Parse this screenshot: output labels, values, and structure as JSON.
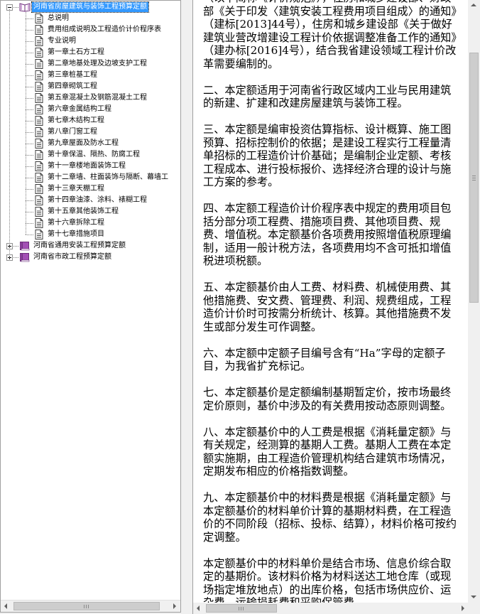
{
  "tree": {
    "books": [
      {
        "label": "河南省房屋建筑与装饰工程预算定额",
        "selected": true,
        "expanded": true,
        "children": [
          "总说明",
          "费用组成说明及工程造价计价程序表",
          "专业说明",
          "第一章土石方工程",
          "第二章地基处理及边坡支护工程",
          "第三章桩基工程",
          "第四章砌筑工程",
          "第五章混凝土及钢筋混凝土工程",
          "第六章金属结构工程",
          "第七章木结构工程",
          "第八章门窗工程",
          "第九章屋面及防水工程",
          "第十章保温、隔热、防腐工程",
          "第十一章楼地面装饰工程",
          "第十二章墙、柱面装饰与隔断、幕墙工",
          "第十三章天棚工程",
          "第十四章油漆、涂料、裱糊工程",
          "第十五章其他装饰工程",
          "第十六章拆除工程",
          "第十七章措施项目"
        ]
      },
      {
        "label": "河南省通用安装工程预算定额",
        "selected": false,
        "expanded": false,
        "children": []
      },
      {
        "label": "河南省市政工程预算定额",
        "selected": false,
        "expanded": false,
        "children": []
      }
    ]
  },
  "document": {
    "paragraphs": [
      "（以下简称《计价规范》），住房和城乡建设部、财政部《关于印发〈建筑安装工程费用项目组成〉的通知》（建标[2013]44号），住房和城乡建设部《关于做好建筑业营改增建设工程计价依据调整准备工作的通知》（建办标[2016]4号），结合我省建设领域工程计价改革需要编制的。",
      "二、本定额适用于河南省行政区域内工业与民用建筑的新建、扩建和改建房屋建筑与装饰工程。",
      "三、本定额是编审投资估算指标、设计概算、施工图预算、招标控制价的依据；是建设工程实行工程量清单招标的工程造价计价基础；是编制企业定额、考核工程成本、进行投标报价、选择经济合理的设计与施工方案的参考。",
      "四、本定额工程造价计价程序表中规定的费用项目包括分部分项工程费、措施项目费、其他项目费、规费、增值税。本定额基价各项费用按照增值税原理编制，适用一般计税方法，各项费用均不含可抵扣增值税进项税额。",
      "五、本定额基价由人工费、材料费、机械使用费、其他措施费、安文费、管理费、利润、规费组成，工程造价计价时可按需分析统计、核算。其他措施费不发生或部分发生可作调整。",
      "六、本定额中定额子目编号含有“Ha”字母的定额子目，为我省扩充标记。",
      "七、本定额基价是定额编制基期暂定价，按市场最终定价原则，基价中涉及的有关费用按动态原则调整。",
      "八、本定额基价中的人工费是根据《消耗量定额》与有关规定，经测算的基期人工费。基期人工费在本定额实施期，由工程造价管理机构结合建筑市场情况，定期发布相应的价格指数调整。",
      "九、本定额基价中的材料费是根据《消耗量定额》与本定额基价的材料单价计算的基期材料费，在工程造价的不同阶段（招标、投标、结算），材料价格可按约定调整。",
      "本定额基价中的材料单价是结合市场、信息价综合取定的基期价。该材料价格为材料送达工地仓库（或现场指定堆放地点）的出库价格，包括市场供应价、运杂费、运输损耗费和采购保管费。"
    ]
  }
}
